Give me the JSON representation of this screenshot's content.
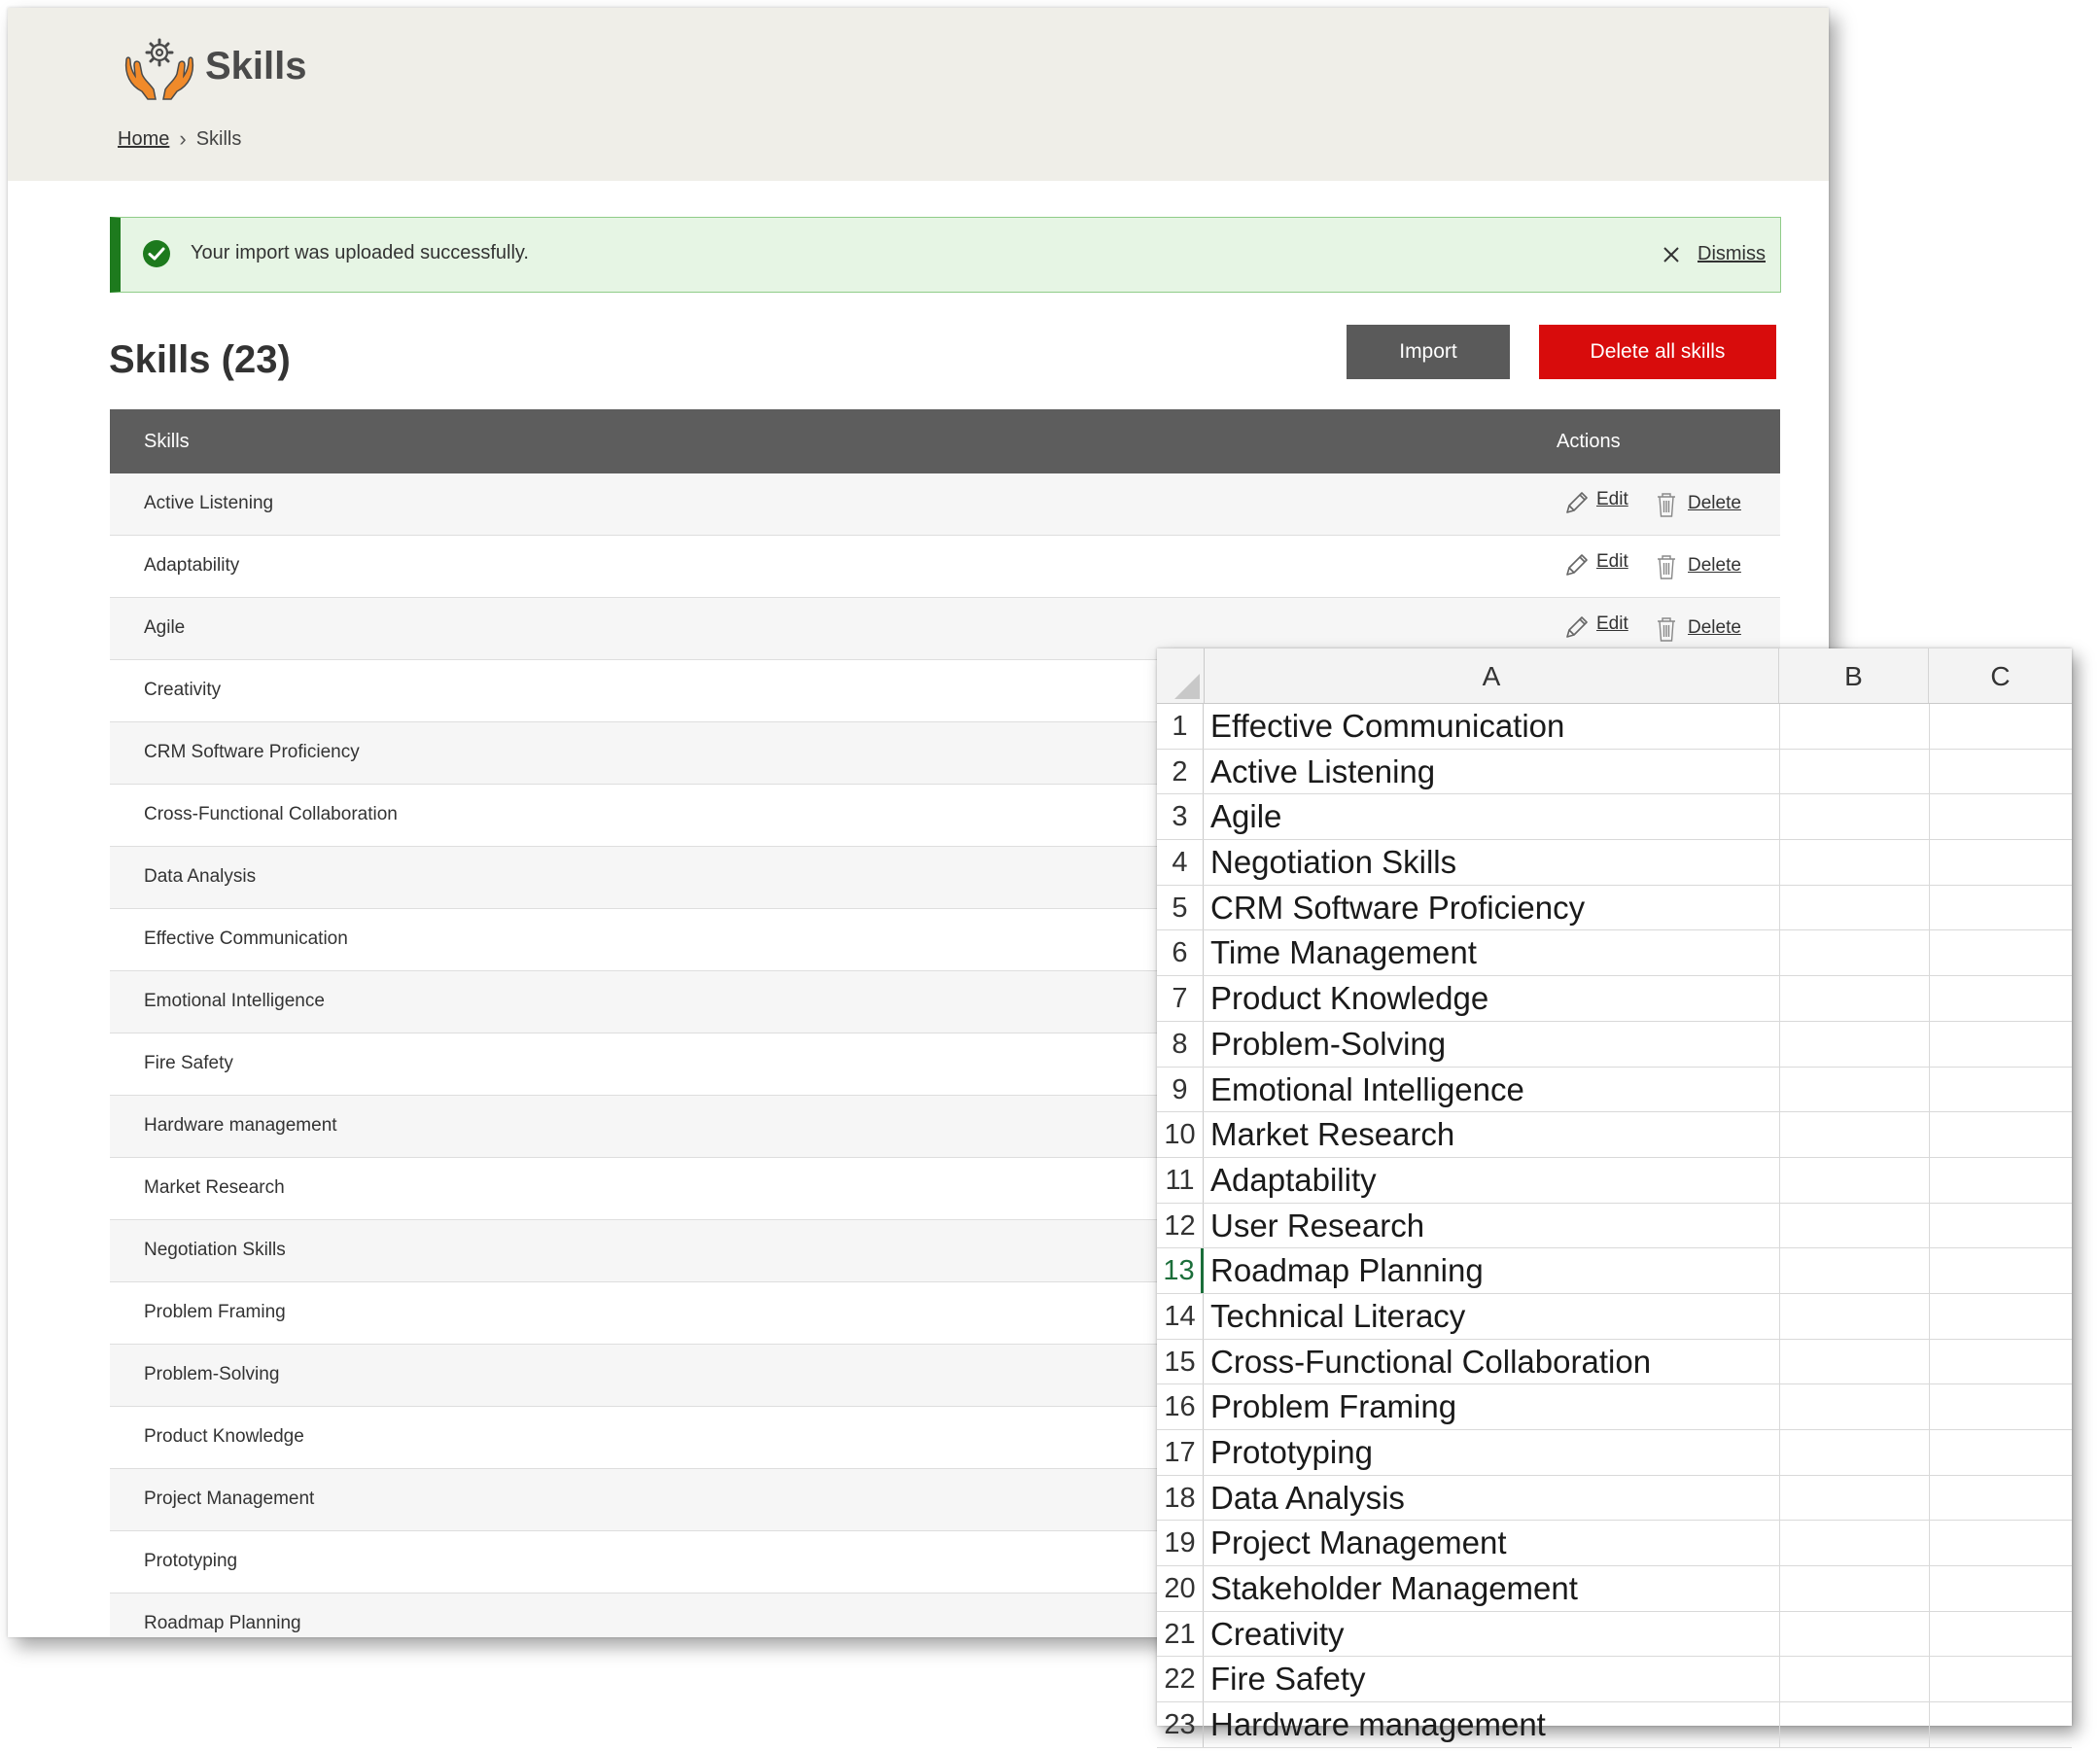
{
  "header": {
    "title": "Skills",
    "logo_icon": "hands-gear-icon",
    "breadcrumb": {
      "home": "Home",
      "separator": "›",
      "current": "Skills"
    }
  },
  "alert": {
    "message": "Your import was uploaded successfully.",
    "dismiss_label": "Dismiss",
    "accent_color": "#1d7a1d"
  },
  "list": {
    "title": "Skills (23)",
    "import_label": "Import",
    "delete_all_label": "Delete all skills",
    "columns": {
      "skills": "Skills",
      "actions": "Actions"
    },
    "edit_label": "Edit",
    "delete_label": "Delete",
    "rows": [
      "Active Listening",
      "Adaptability",
      "Agile",
      "Creativity",
      "CRM Software Proficiency",
      "Cross-Functional Collaboration",
      "Data Analysis",
      "Effective Communication",
      "Emotional Intelligence",
      "Fire Safety",
      "Hardware management",
      "Market Research",
      "Negotiation Skills",
      "Problem Framing",
      "Problem-Solving",
      "Product Knowledge",
      "Project Management",
      "Prototyping",
      "Roadmap Planning"
    ]
  },
  "spreadsheet": {
    "columns": [
      "A",
      "B",
      "C"
    ],
    "active_row": 13,
    "rows": [
      "Effective Communication",
      "Active Listening",
      "Agile",
      "Negotiation Skills",
      "CRM Software Proficiency",
      "Time Management",
      "Product Knowledge",
      "Problem-Solving",
      "Emotional Intelligence",
      "Market Research",
      "Adaptability",
      "User Research",
      "Roadmap Planning",
      "Technical Literacy",
      "Cross-Functional Collaboration",
      "Problem Framing",
      "Prototyping",
      "Data Analysis",
      "Project Management",
      "Stakeholder Management",
      "Creativity",
      "Fire Safety",
      "Hardware management"
    ]
  }
}
